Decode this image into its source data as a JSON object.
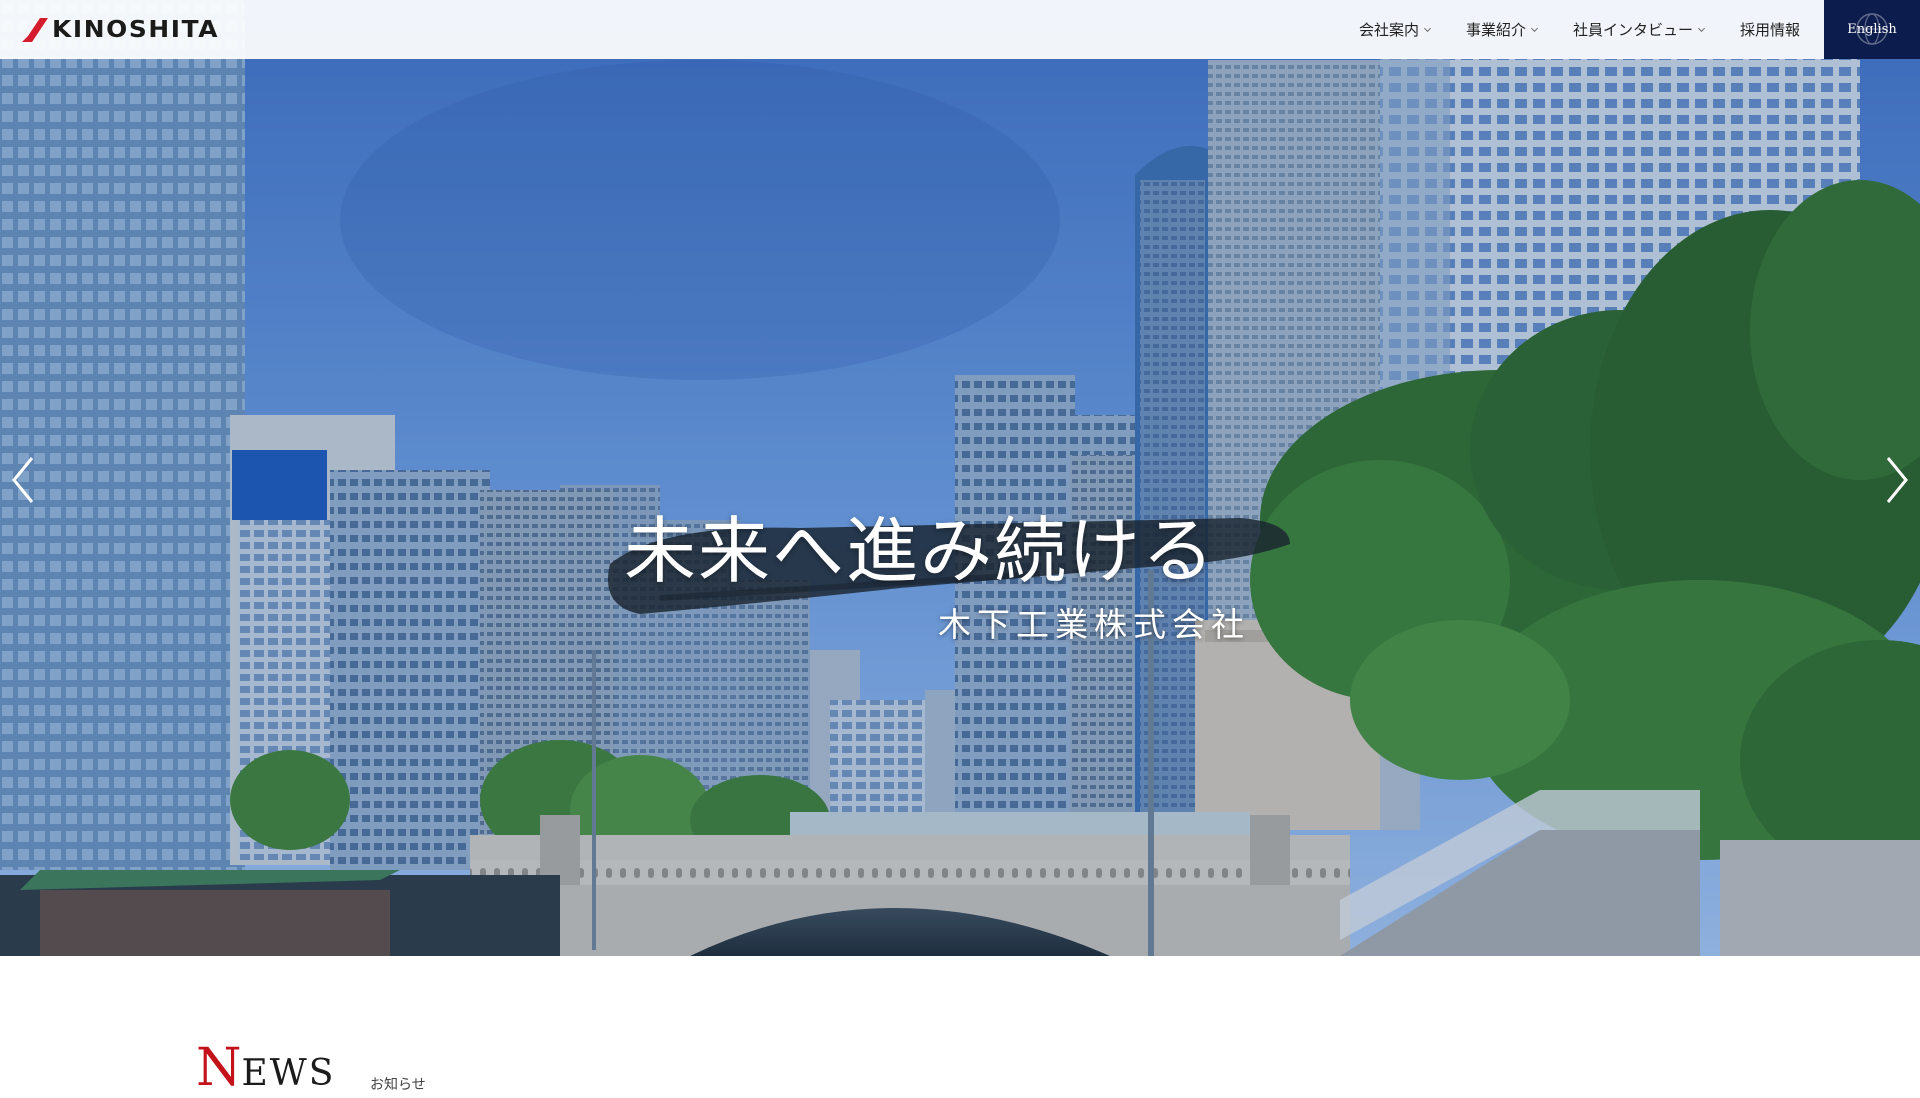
{
  "brand": {
    "name": "KINOSHITA",
    "accent_color": "#d41c2c",
    "navy_color": "#0c1c4d"
  },
  "nav": {
    "items": [
      {
        "label": "会社案内",
        "has_dropdown": true
      },
      {
        "label": "事業紹介",
        "has_dropdown": true
      },
      {
        "label": "社員インタビュー",
        "has_dropdown": true
      },
      {
        "label": "採用情報",
        "has_dropdown": false
      }
    ],
    "language_button": "English",
    "icons": [
      "chevron-down-icon",
      "globe-icon"
    ]
  },
  "hero": {
    "headline": "未来へ進み続ける",
    "company": "木下工業株式会社",
    "icons": [
      "arrow-left-icon",
      "arrow-right-icon"
    ]
  },
  "news": {
    "initial": "N",
    "rest": "EWS",
    "subtitle": "お知らせ"
  }
}
